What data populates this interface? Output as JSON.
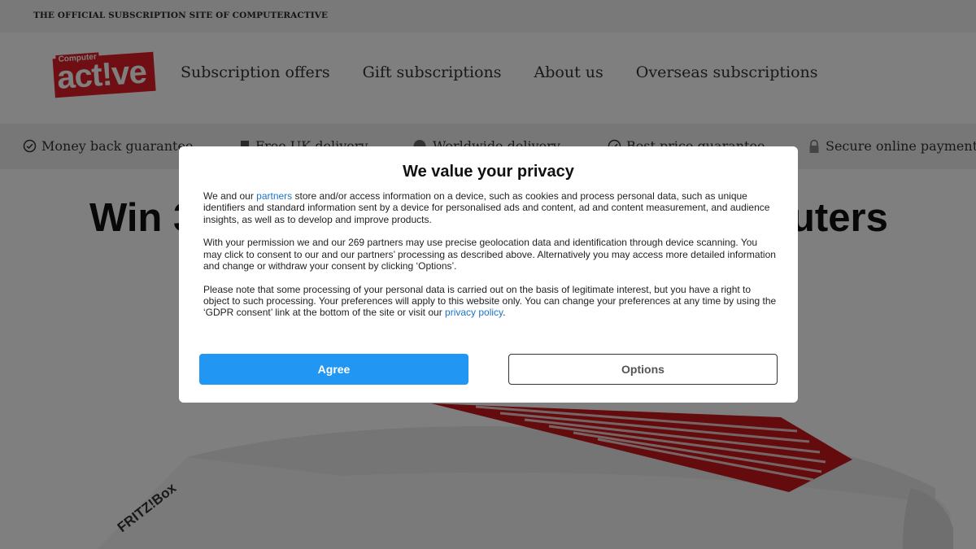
{
  "topbar": {
    "text": "THE OFFICIAL SUBSCRIPTION SITE OF COMPUTERACTIVE"
  },
  "logo": {
    "small": "Computer",
    "main": "act!ve"
  },
  "nav": [
    {
      "label": "Subscription offers"
    },
    {
      "label": "Gift subscriptions"
    },
    {
      "label": "About us"
    },
    {
      "label": "Overseas subscriptions"
    }
  ],
  "benefits": [
    {
      "label": "Money back guarantee",
      "icon": "check-circle-icon"
    },
    {
      "label": "Free UK delivery",
      "icon": "truck-icon"
    },
    {
      "label": "Worldwide delivery",
      "icon": "globe-icon"
    },
    {
      "label": "Best price guarantee",
      "icon": "badge-icon"
    },
    {
      "label": "Secure online payment",
      "icon": "lock-icon"
    }
  ],
  "headline": {
    "left": "Win 3",
    "right": "uters"
  },
  "product": {
    "brand": "FRITZ!Box"
  },
  "consent": {
    "title": "We value your privacy",
    "p1_before": "We and our ",
    "p1_link": "partners",
    "p1_after": " store and/or access information on a device, such as cookies and process personal data, such as unique identifiers and standard information sent by a device for personalised ads and content, ad and content measurement, and audience insights, as well as to develop and improve products.",
    "p2": "With your permission we and our 269 partners may use precise geolocation data and identification through device scanning. You may click to consent to our and our partners’ processing as described above. Alternatively you may access more detailed information and change or withdraw your consent by clicking ‘Options’.",
    "p3_before": "Please note that some processing of your personal data is carried out on the basis of legitimate interest, but you have a right to object to such processing. Your preferences will apply to this website only. You can change your preferences at any time by using the ‘GDPR consent’ link at the bottom of the site or visit our ",
    "p3_link": "privacy policy",
    "p3_after": ".",
    "agree_label": "Agree",
    "options_label": "Options"
  },
  "colors": {
    "accent": "#2196f3",
    "brand_red": "#e01e26",
    "link": "#1a73c8"
  }
}
